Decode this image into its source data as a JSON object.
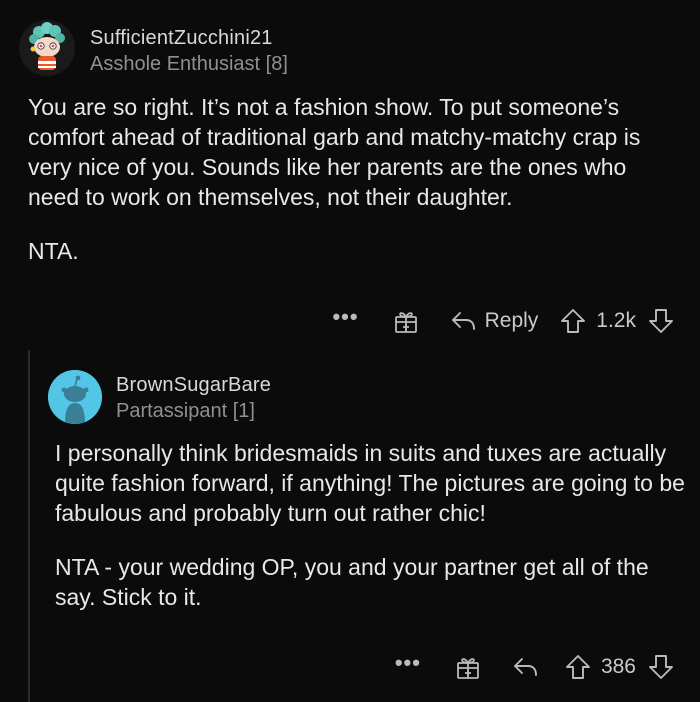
{
  "comments": [
    {
      "username": "SufficientZucchini21",
      "flair": "Asshole Enthusiast [8]",
      "paragraphs": [
        "You are so right. It’s not a fashion show. To put someone’s comfort ahead of traditional garb and matchy-matchy crap is very nice of you. Sounds like her parents are the ones who need to work on themselves, not their daughter.",
        "NTA."
      ],
      "actions": {
        "more": "•••",
        "reply_label": "Reply",
        "votes": "1.2k"
      }
    },
    {
      "username": "BrownSugarBare",
      "flair": "Partassipant [1]",
      "paragraphs": [
        "I personally think bridesmaids in suits and tuxes are actually quite fashion forward, if anything! The pictures are going to be fabulous and probably turn out rather chic!",
        "NTA - your wedding OP, you and your partner get all of the say. Stick to it."
      ],
      "actions": {
        "more": "•••",
        "reply_label": "",
        "votes": "386"
      }
    }
  ],
  "colors": {
    "background": "#0b0b0b",
    "text": "#e8e8e8",
    "muted": "#8d9094",
    "avatar_blue": "#52c6e6"
  },
  "icons": [
    "gift-award-icon",
    "reply-arrow-icon",
    "upvote-arrow-icon",
    "downvote-arrow-icon",
    "more-options-icon"
  ]
}
